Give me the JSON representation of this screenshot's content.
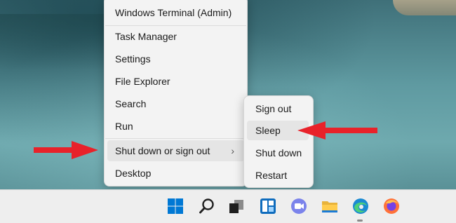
{
  "context_menu": {
    "items": [
      {
        "label": "Windows Terminal (Admin)"
      },
      {
        "label": "Task Manager"
      },
      {
        "label": "Settings"
      },
      {
        "label": "File Explorer"
      },
      {
        "label": "Search"
      },
      {
        "label": "Run"
      },
      {
        "label": "Shut down or sign out",
        "chevron": "›"
      },
      {
        "label": "Desktop"
      }
    ]
  },
  "submenu": {
    "items": [
      {
        "label": "Sign out"
      },
      {
        "label": "Sleep"
      },
      {
        "label": "Shut down"
      },
      {
        "label": "Restart"
      }
    ]
  },
  "taskbar": {
    "icons": [
      "start-icon",
      "search-icon",
      "task-view-icon",
      "widgets-icon",
      "teams-chat-icon",
      "file-explorer-icon",
      "edge-icon",
      "firefox-icon"
    ]
  },
  "annotations": {
    "arrow_color": "#e8222a",
    "arrow_targets": [
      "Shut down or sign out",
      "Sleep"
    ]
  },
  "colors": {
    "menu_bg": "#f3f3f3",
    "hover_bg": "#e5e5e5",
    "taskbar_bg": "#eeeeee",
    "windows_blue": "#0078d4"
  }
}
